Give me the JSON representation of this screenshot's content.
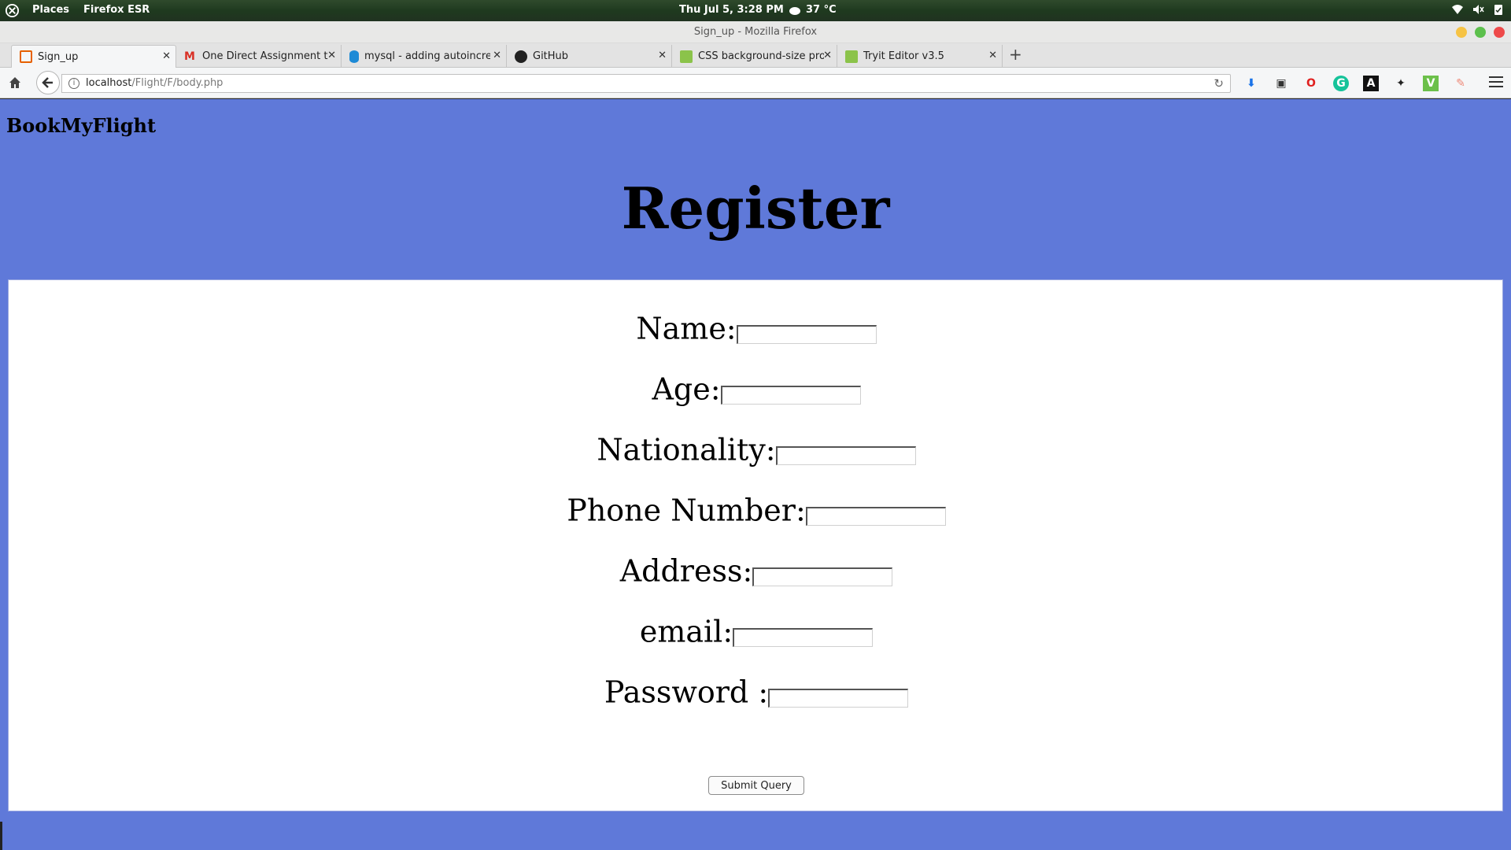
{
  "desktop": {
    "places": "Places",
    "app": "Firefox ESR",
    "clock": "Thu Jul  5,  3:28 PM",
    "temperature": "37 °C"
  },
  "window": {
    "title": "Sign_up - Mozilla Firefox"
  },
  "tabs": [
    {
      "title": "Sign_up",
      "color": "#e66000"
    },
    {
      "title": "One Direct Assignment t...",
      "color": "#d93025"
    },
    {
      "title": "mysql - adding autoincre...",
      "color": "#1d8ad6"
    },
    {
      "title": "GitHub",
      "color": "#222222"
    },
    {
      "title": "CSS background-size pro...",
      "color": "#8bc34a"
    },
    {
      "title": "Tryit Editor v3.5",
      "color": "#8bc34a"
    }
  ],
  "navbar": {
    "url_host": "localhost",
    "url_path": "/Flight/F/body.php"
  },
  "page": {
    "brand": "BookMyFlight",
    "heading": "Register",
    "background": "#5f79d9",
    "fields": [
      {
        "label": "Name:",
        "value": ""
      },
      {
        "label": "Age:",
        "value": ""
      },
      {
        "label": "Nationality:",
        "value": ""
      },
      {
        "label": "Phone Number:",
        "value": ""
      },
      {
        "label": "Address:",
        "value": ""
      },
      {
        "label": "email:",
        "value": ""
      },
      {
        "label": "Password :",
        "value": ""
      }
    ],
    "submit": "Submit Query"
  }
}
